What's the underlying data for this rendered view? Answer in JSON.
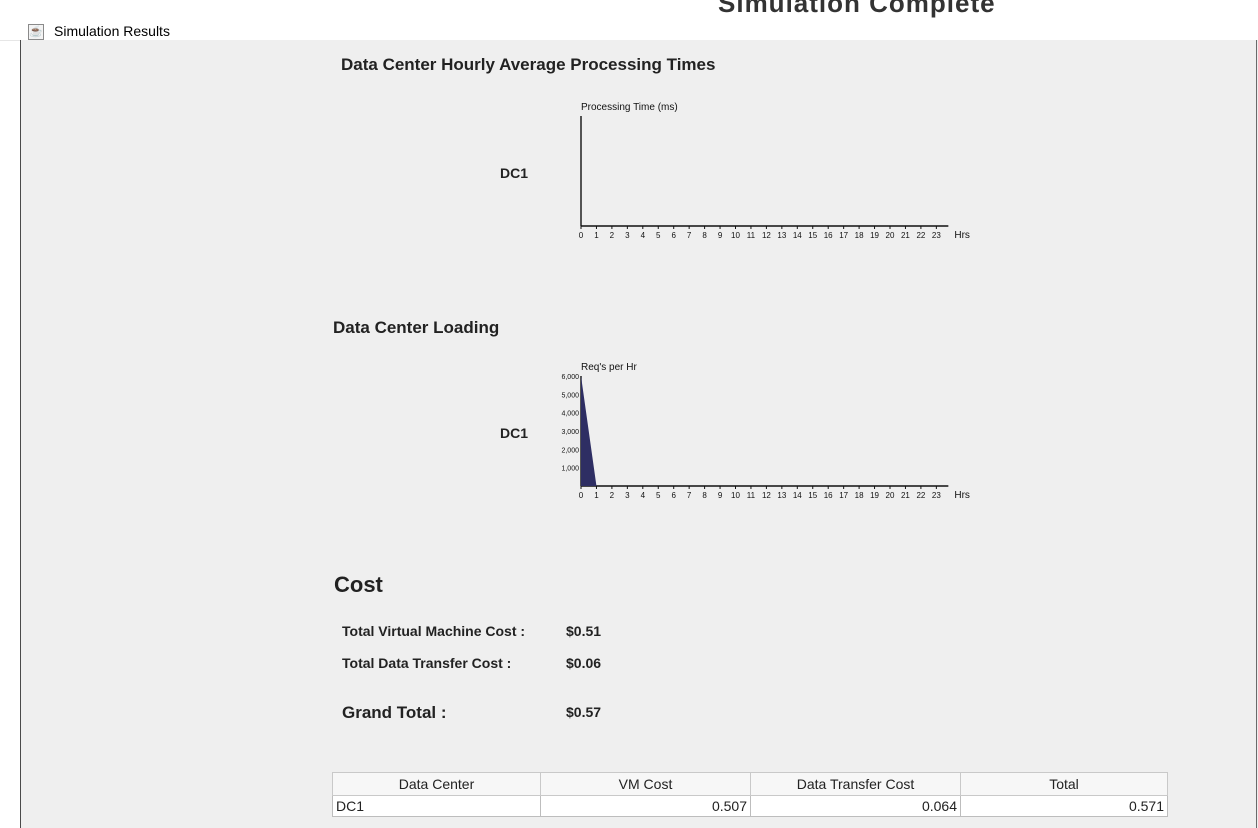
{
  "window": {
    "title": "Simulation Results",
    "overflow_heading": "Simulation Complete"
  },
  "processing_section": {
    "title": "Data Center Hourly Average Processing Times",
    "dc_label": "DC1"
  },
  "loading_section": {
    "title": "Data Center Loading",
    "dc_label": "DC1"
  },
  "cost": {
    "title": "Cost",
    "vm_cost_label": "Total Virtual Machine Cost :",
    "vm_cost_value": "$0.51",
    "transfer_cost_label": "Total Data Transfer Cost :",
    "transfer_cost_value": "$0.06",
    "grand_total_label": "Grand Total :",
    "grand_total_value": "$0.57"
  },
  "table": {
    "headers": [
      "Data Center",
      "VM Cost",
      "Data Transfer Cost",
      "Total"
    ],
    "rows": [
      {
        "data_center": "DC1",
        "vm_cost": "0.507",
        "data_transfer_cost": "0.064",
        "total": "0.571"
      }
    ]
  },
  "chart_data": [
    {
      "type": "bar",
      "title": "Data Center Hourly Average Processing Times",
      "series": [
        {
          "name": "DC1",
          "values": []
        }
      ],
      "categories": [
        "0",
        "1",
        "2",
        "3",
        "4",
        "5",
        "6",
        "7",
        "8",
        "9",
        "10",
        "11",
        "12",
        "13",
        "14",
        "15",
        "16",
        "17",
        "18",
        "19",
        "20",
        "21",
        "22",
        "23"
      ],
      "xlabel": "Hrs",
      "ylabel": "Processing Time (ms)"
    },
    {
      "type": "area",
      "title": "Data Center Loading",
      "series": [
        {
          "name": "DC1",
          "values": [
            6000,
            0,
            0,
            0,
            0,
            0,
            0,
            0,
            0,
            0,
            0,
            0,
            0,
            0,
            0,
            0,
            0,
            0,
            0,
            0,
            0,
            0,
            0,
            0
          ]
        }
      ],
      "categories": [
        "0",
        "1",
        "2",
        "3",
        "4",
        "5",
        "6",
        "7",
        "8",
        "9",
        "10",
        "11",
        "12",
        "13",
        "14",
        "15",
        "16",
        "17",
        "18",
        "19",
        "20",
        "21",
        "22",
        "23"
      ],
      "xlabel": "Hrs",
      "ylabel": "Req's per Hr",
      "yticks": [
        "1,000",
        "2,000",
        "3,000",
        "4,000",
        "5,000",
        "6,000"
      ],
      "ylim": [
        0,
        6000
      ],
      "color": "#2e2e63"
    }
  ]
}
